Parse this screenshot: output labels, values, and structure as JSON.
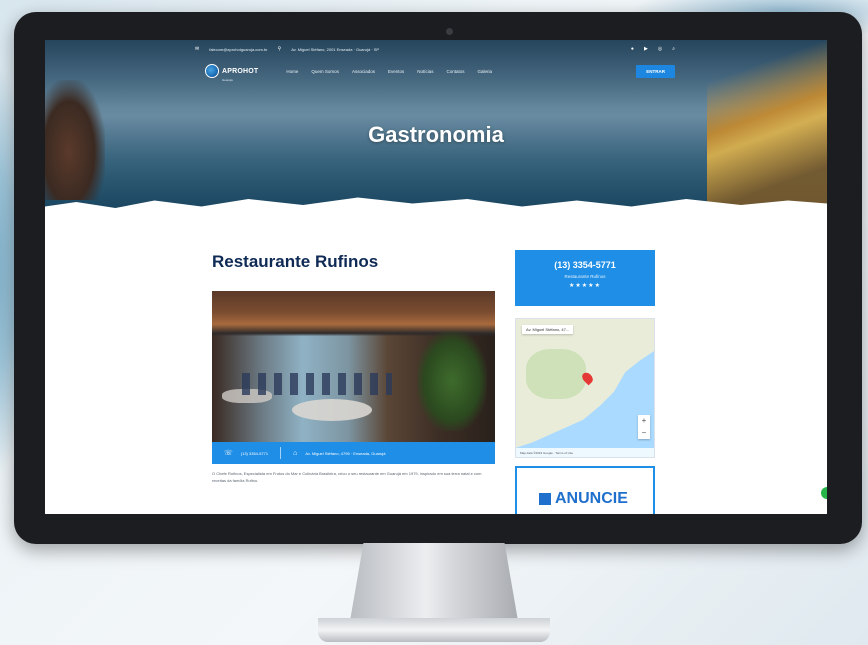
{
  "website": {
    "topbar": {
      "email": "falecom@aprohotguaruja.com.br",
      "address": "Av. Miguel Stéfano, 2001 Enseada · Guarujá · SP"
    },
    "logo": {
      "name": "APROHOT",
      "sub": "Guarujá"
    },
    "nav": {
      "items": [
        "Home",
        "Quem Somos",
        "Associados",
        "Eventos",
        "Notícias",
        "Contatos",
        "Galeria"
      ],
      "cta_label": "ENTRAR"
    },
    "hero_title": "Gastronomia",
    "restaurant": {
      "name": "Restaurante Rufinos",
      "phone_short": "(13) 3354-5771",
      "address": "Av. Miguel Stéfano, 4795 · Enseada, Guarujá",
      "description": "O Chefe Rufinos, Especialista em Frutos do Mar e Culinária Brasileira, criou o seu restaurante em Guarujá em 1979, inspirado em sua terra natal e com receitas da família Rufino."
    },
    "sidebar": {
      "phone": "(13) 3354-5771",
      "name": "Restaurante Rufinos",
      "stars": "★★★★★"
    },
    "map": {
      "tag": "Av. Miguel Stéfano, 47...",
      "zoom_in": "+",
      "zoom_out": "−",
      "footer": "Map data ©2019 Google · Terms of Use"
    },
    "ad_label": "ANUNCIE"
  }
}
